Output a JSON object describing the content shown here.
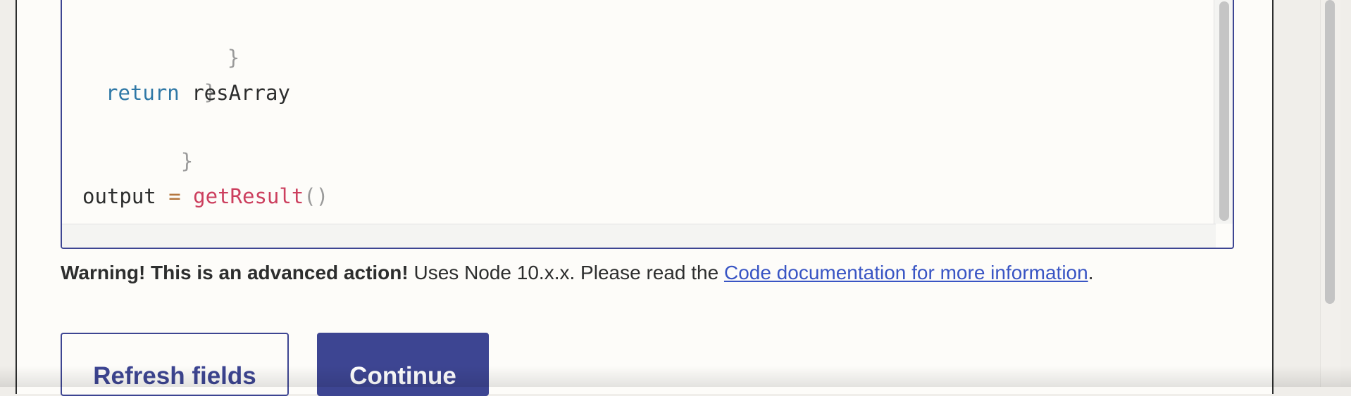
{
  "code_editor": {
    "lines": [
      [
        {
          "t": "}",
          "c": "brace"
        }
      ],
      [
        {
          "t": "}",
          "c": "brace"
        }
      ],
      [
        {
          "t": "return",
          "c": "keyword"
        },
        {
          "t": " resArray",
          "c": "var"
        }
      ],
      [
        {
          "t": "}",
          "c": "brace"
        }
      ],
      [],
      [
        {
          "t": "output",
          "c": "var"
        },
        {
          "t": " = ",
          "c": "op"
        },
        {
          "t": "getResult",
          "c": "fn"
        },
        {
          "t": "()",
          "c": "paren"
        }
      ]
    ]
  },
  "warning": {
    "bold_text": "Warning! This is an advanced action!",
    "text": " Uses Node 10.x.x. Please read the ",
    "link_text": "Code documentation for more information",
    "suffix": "."
  },
  "buttons": {
    "refresh_label": "Refresh fields",
    "continue_label": "Continue"
  }
}
